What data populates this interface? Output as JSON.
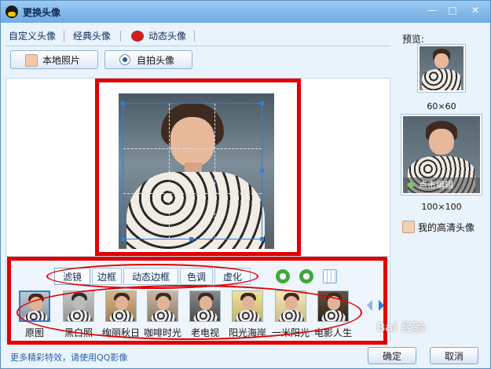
{
  "window": {
    "title": "更换头像"
  },
  "tabs": [
    "自定义头像",
    "经典头像",
    "动态头像"
  ],
  "toolbar": {
    "local_photo": "本地照片",
    "selfie": "自拍头像"
  },
  "filter_tabs": [
    "滤镜",
    "边框",
    "动态边框",
    "色调",
    "虚化"
  ],
  "filters": [
    "原图",
    "黑白照",
    "绚丽秋日",
    "咖啡时光",
    "老电视",
    "阳光海岸",
    "一米阳光",
    "电影人生"
  ],
  "footer": {
    "hint": "更多精彩特效，请使用QQ影像",
    "ok": "确定",
    "cancel": "取消"
  },
  "preview": {
    "label": "预览:",
    "small_size": "60×60",
    "big_size": "100×100",
    "edit": "点击编辑",
    "hd_avatar": "我的高清头像"
  },
  "watermark": "Bai 经验",
  "colors": {
    "highlight": "#e10000",
    "accent": "#2f7de0"
  },
  "icons": {
    "rotate_left": "rotate-left-icon",
    "rotate_right": "rotate-right-icon",
    "grid": "grid-icon"
  }
}
